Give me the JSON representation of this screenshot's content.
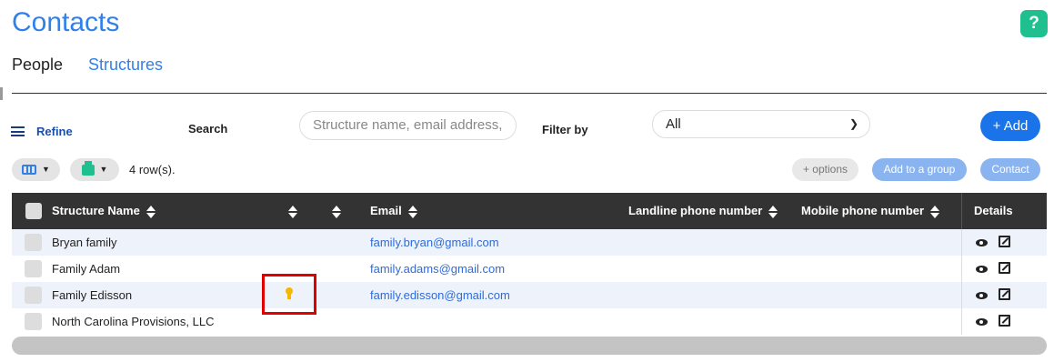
{
  "header": {
    "title": "Contacts",
    "help_label": "?"
  },
  "tabs": [
    {
      "label": "People",
      "active": false
    },
    {
      "label": "Structures",
      "active": true
    }
  ],
  "toolbar": {
    "refine_label": "Refine",
    "search_label": "Search",
    "search_placeholder": "Structure name, email address,",
    "filter_label": "Filter by",
    "filter_value": "All",
    "add_label": "+ Add",
    "row_count": "4 row(s).",
    "options_label": "+ options",
    "add_to_group_label": "Add to a group",
    "contact_label": "Contact"
  },
  "table": {
    "columns": {
      "name": "Structure Name",
      "email": "Email",
      "landline": "Landline phone number",
      "mobile": "Mobile phone number",
      "details": "Details"
    },
    "rows": [
      {
        "name": "Bryan family",
        "email": "family.bryan@gmail.com"
      },
      {
        "name": "Family Adam",
        "email": "family.adams@gmail.com"
      },
      {
        "name": "Family Edisson",
        "email": "family.edisson@gmail.com",
        "badge": "award-icon"
      },
      {
        "name": "North Carolina Provisions, LLC",
        "email": ""
      }
    ]
  },
  "colors": {
    "accent": "#2f80ed",
    "primary_button": "#1a73e8",
    "help": "#1fbf8f",
    "header_bg": "#333333",
    "highlight": "#e00000"
  }
}
